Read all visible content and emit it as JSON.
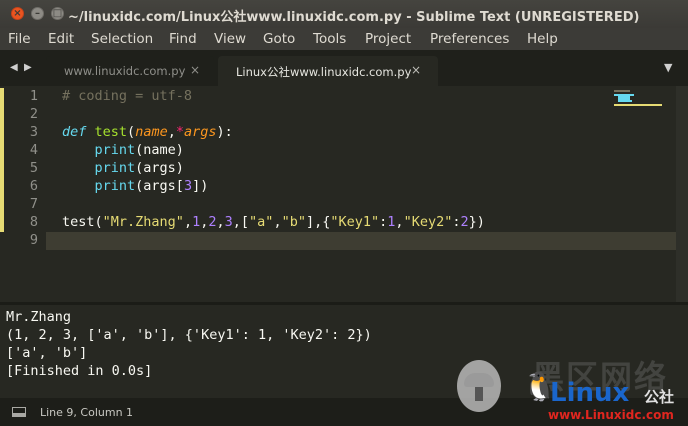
{
  "window": {
    "title": "~/linuxidc.com/Linux公社www.linuxidc.com.py - Sublime Text (UNREGISTERED)",
    "buttons": {
      "close_glyph": "×",
      "min_glyph": "–",
      "max_glyph": "□"
    }
  },
  "menu": [
    "File",
    "Edit",
    "Selection",
    "Find",
    "View",
    "Goto",
    "Tools",
    "Project",
    "Preferences",
    "Help"
  ],
  "tabs": {
    "nav_left": "◀",
    "nav_right": "▶",
    "items": [
      {
        "label": "www.linuxidc.com.py",
        "close": "×"
      },
      {
        "label": "Linux公社www.linuxidc.com.py",
        "close": "×"
      }
    ],
    "dropdown": "▼"
  },
  "editor": {
    "line_numbers": [
      "1",
      "2",
      "3",
      "4",
      "5",
      "6",
      "7",
      "8",
      "9"
    ],
    "lines": [
      [
        {
          "t": "# coding = utf-8",
          "c": "cmt"
        }
      ],
      [],
      [
        {
          "t": "def",
          "c": "kw"
        },
        {
          "t": " ",
          "c": ""
        },
        {
          "t": "test",
          "c": "fn"
        },
        {
          "t": "(",
          "c": ""
        },
        {
          "t": "name",
          "c": "param"
        },
        {
          "t": ",",
          "c": ""
        },
        {
          "t": "*",
          "c": "op"
        },
        {
          "t": "args",
          "c": "param"
        },
        {
          "t": "):",
          "c": ""
        }
      ],
      [
        {
          "t": "    ",
          "c": ""
        },
        {
          "t": "print",
          "c": "bi"
        },
        {
          "t": "(name)",
          "c": ""
        }
      ],
      [
        {
          "t": "    ",
          "c": ""
        },
        {
          "t": "print",
          "c": "bi"
        },
        {
          "t": "(args)",
          "c": ""
        }
      ],
      [
        {
          "t": "    ",
          "c": ""
        },
        {
          "t": "print",
          "c": "bi"
        },
        {
          "t": "(args[",
          "c": ""
        },
        {
          "t": "3",
          "c": "num"
        },
        {
          "t": "])",
          "c": ""
        }
      ],
      [],
      [
        {
          "t": "test",
          "c": ""
        },
        {
          "t": "(",
          "c": ""
        },
        {
          "t": "\"Mr.Zhang\"",
          "c": "str"
        },
        {
          "t": ",",
          "c": ""
        },
        {
          "t": "1",
          "c": "num"
        },
        {
          "t": ",",
          "c": ""
        },
        {
          "t": "2",
          "c": "num"
        },
        {
          "t": ",",
          "c": ""
        },
        {
          "t": "3",
          "c": "num"
        },
        {
          "t": ",[",
          "c": ""
        },
        {
          "t": "\"a\"",
          "c": "str"
        },
        {
          "t": ",",
          "c": ""
        },
        {
          "t": "\"b\"",
          "c": "str"
        },
        {
          "t": "],{",
          "c": ""
        },
        {
          "t": "\"Key1\"",
          "c": "str"
        },
        {
          "t": ":",
          "c": ""
        },
        {
          "t": "1",
          "c": "num"
        },
        {
          "t": ",",
          "c": ""
        },
        {
          "t": "\"Key2\"",
          "c": "str"
        },
        {
          "t": ":",
          "c": ""
        },
        {
          "t": "2",
          "c": "num"
        },
        {
          "t": "})",
          "c": ""
        }
      ],
      []
    ],
    "modified_lines": [
      1,
      8
    ],
    "current_line": 9,
    "colors": {
      "background": "#272822",
      "comment": "#75715e",
      "keyword": "#66d9ef",
      "function": "#a6e22e",
      "string": "#e6db74",
      "number": "#ae81ff",
      "operator": "#f92672",
      "parameter": "#fd971f"
    }
  },
  "output": [
    "Mr.Zhang",
    "(1, 2, 3, ['a', 'b'], {'Key1': 1, 'Key2': 2})",
    "['a', 'b']",
    "[Finished in 0.0s]"
  ],
  "status": {
    "position": "Line 9, Column 1"
  },
  "watermark": {
    "ghost_text": "黑区网络",
    "brand": "Linux",
    "brand_cn": "公社",
    "url": "www.Linuxidc.com",
    "peng_glyph": "🐧"
  }
}
